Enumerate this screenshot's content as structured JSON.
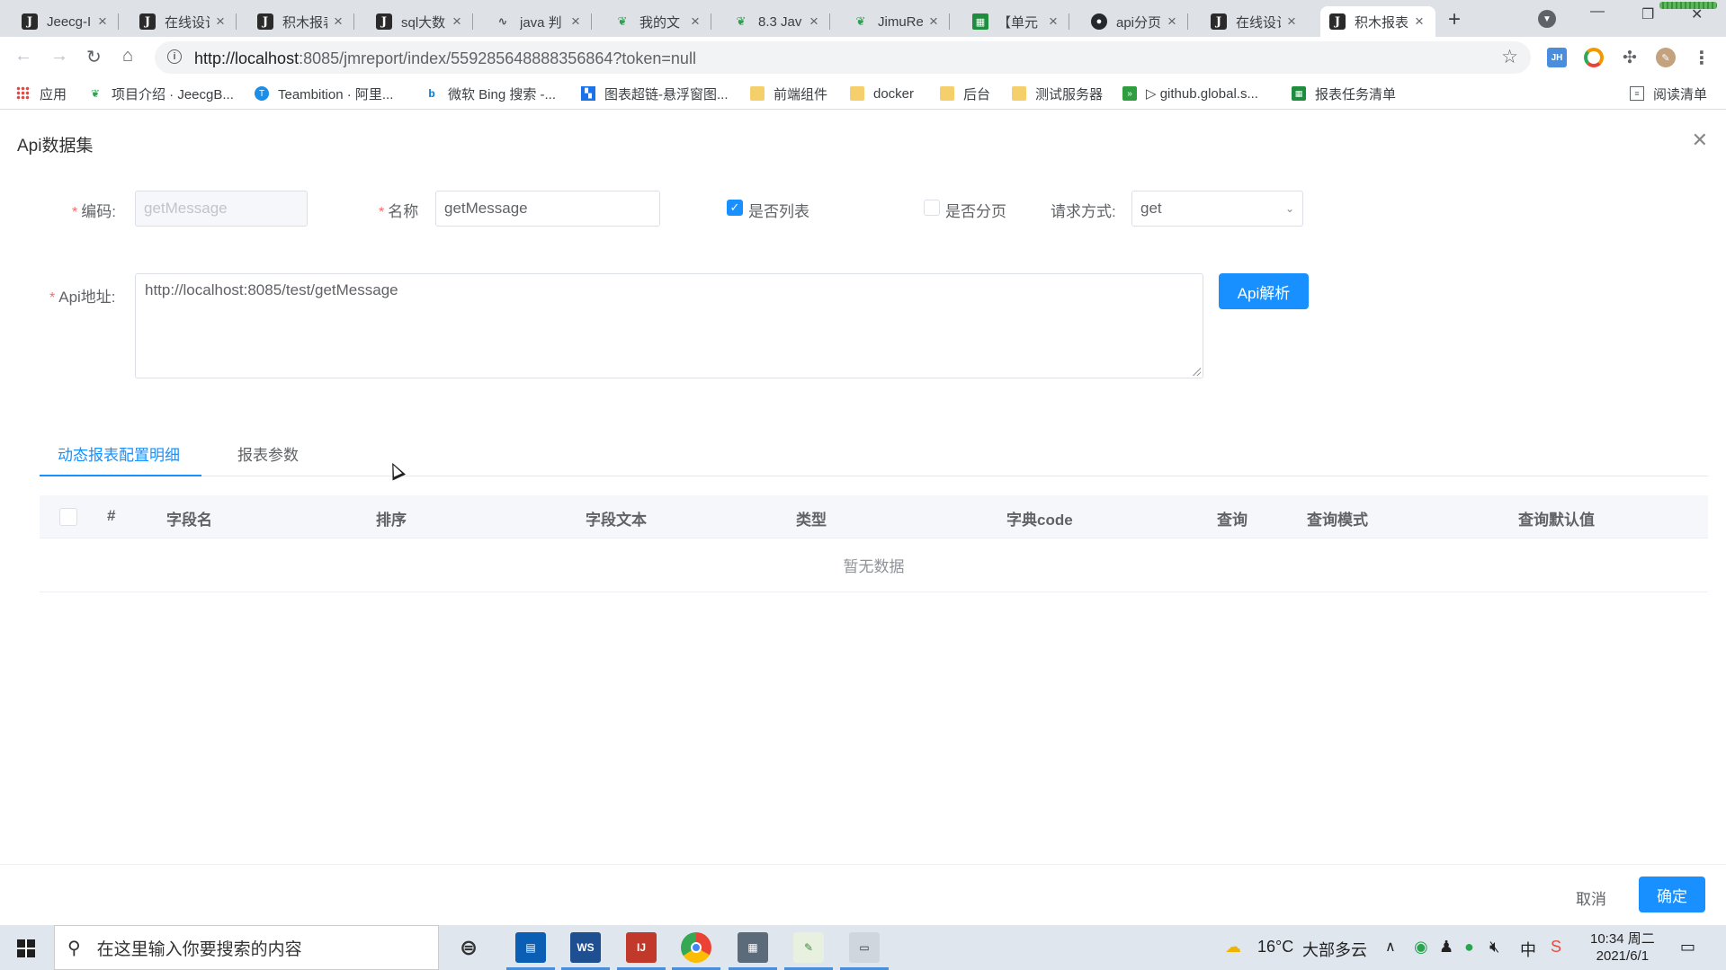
{
  "browser": {
    "tabs": [
      {
        "title": "Jeecg-I",
        "icon": "j-icon"
      },
      {
        "title": "在线设计",
        "icon": "j-icon"
      },
      {
        "title": "积木报表",
        "icon": "j-icon"
      },
      {
        "title": "sql大数",
        "icon": "j-icon"
      },
      {
        "title": "java 判",
        "icon": "yuque-icon"
      },
      {
        "title": "我的文",
        "icon": "yuque-green-icon"
      },
      {
        "title": "8.3 Jav",
        "icon": "yuque-green-icon"
      },
      {
        "title": "JimuRe",
        "icon": "yuque-green-icon"
      },
      {
        "title": "【单元",
        "icon": "sheet-icon"
      },
      {
        "title": "api分页",
        "icon": "github-icon"
      },
      {
        "title": "在线设计",
        "icon": "j-icon"
      },
      {
        "title": "积木报表",
        "icon": "j-icon",
        "active": true
      }
    ],
    "url_host": "http://localhost",
    "url_rest": ":8085/jmreport/index/559285648888356864?token=null"
  },
  "bookmarks": [
    {
      "label": "应用",
      "icon": "apps-grid-icon"
    },
    {
      "label": "项目介绍 · JeecgB...",
      "icon": "jeecg-icon"
    },
    {
      "label": "Teambition · 阿里...",
      "icon": "teambition-icon"
    },
    {
      "label": "微软 Bing 搜索 -...",
      "icon": "bing-icon"
    },
    {
      "label": "图表超链-悬浮窗图...",
      "icon": "map-icon"
    },
    {
      "label": "前端组件",
      "icon": "folder-icon"
    },
    {
      "label": "docker",
      "icon": "folder-icon"
    },
    {
      "label": "后台",
      "icon": "folder-icon"
    },
    {
      "label": "测试服务器",
      "icon": "folder-icon"
    },
    {
      "label": "▷ github.global.s...",
      "icon": "github-global-icon"
    },
    {
      "label": "报表任务清单",
      "icon": "sheet-icon"
    },
    {
      "label": "阅读清单",
      "icon": "reading-list-icon"
    }
  ],
  "modal": {
    "title": "Api数据集",
    "form": {
      "code_label": "编码:",
      "code_value": "getMessage",
      "name_label": "名称",
      "name_value": "getMessage",
      "is_list_label": "是否列表",
      "is_list_checked": true,
      "is_paged_label": "是否分页",
      "is_paged_checked": false,
      "method_label": "请求方式:",
      "method_value": "get",
      "api_label": "Api地址:",
      "api_value": "http://localhost:8085/test/getMessage",
      "parse_button": "Api解析"
    },
    "tabs": [
      "动态报表配置明细",
      "报表参数"
    ],
    "active_tab": 0,
    "table": {
      "headers": [
        "#",
        "字段名",
        "排序",
        "字段文本",
        "类型",
        "字典code",
        "查询",
        "查询模式",
        "查询默认值"
      ],
      "empty_text": "暂无数据"
    },
    "footer": {
      "cancel": "取消",
      "ok": "确定"
    }
  },
  "taskbar": {
    "search_placeholder": "在这里输入你要搜索的内容",
    "weather_temp": "16°C",
    "weather_text": "大部多云",
    "ime": "中",
    "time": "10:34 周二",
    "date": "2021/6/1"
  },
  "colors": {
    "primary": "#1890ff",
    "required": "#f56c6c"
  }
}
